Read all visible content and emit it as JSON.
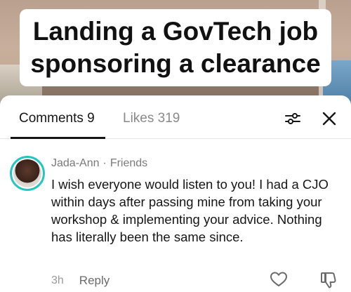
{
  "video": {
    "caption_line1": "Landing a GovTech job",
    "caption_line2": "sponsoring a clearance"
  },
  "tabs": {
    "comments_label": "Comments 9",
    "likes_label": "Likes 319",
    "active": "comments"
  },
  "icons": {
    "filter": "sliders-icon",
    "close": "close-icon",
    "like": "heart-icon",
    "dislike": "thumbs-down-icon"
  },
  "comment": {
    "author": "Jada-Ann",
    "separator": "·",
    "relation": "Friends",
    "text": "I wish everyone would listen to you! I had a CJO within days after passing mine from taking your workshop & implementing your advice. Nothing has literally been the same since.",
    "time": "3h",
    "reply_label": "Reply"
  },
  "colors": {
    "avatar_ring": "#26c6c0",
    "text_primary": "#161616",
    "text_secondary": "#7a7a7a"
  }
}
